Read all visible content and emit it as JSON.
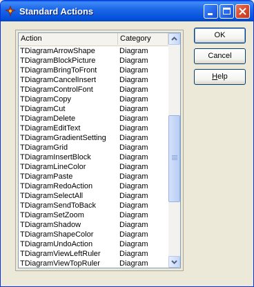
{
  "window": {
    "title": "Standard Actions"
  },
  "list": {
    "columns": [
      "Action",
      "Category"
    ],
    "rows": [
      [
        "TDiagramArrowShape",
        "Diagram"
      ],
      [
        "TDiagramBlockPicture",
        "Diagram"
      ],
      [
        "TDiagramBringToFront",
        "Diagram"
      ],
      [
        "TDiagramCancelInsert",
        "Diagram"
      ],
      [
        "TDiagramControlFont",
        "Diagram"
      ],
      [
        "TDiagramCopy",
        "Diagram"
      ],
      [
        "TDiagramCut",
        "Diagram"
      ],
      [
        "TDiagramDelete",
        "Diagram"
      ],
      [
        "TDiagramEditText",
        "Diagram"
      ],
      [
        "TDiagramGradientSetting",
        "Diagram"
      ],
      [
        "TDiagramGrid",
        "Diagram"
      ],
      [
        "TDiagramInsertBlock",
        "Diagram"
      ],
      [
        "TDiagramLineColor",
        "Diagram"
      ],
      [
        "TDiagramPaste",
        "Diagram"
      ],
      [
        "TDiagramRedoAction",
        "Diagram"
      ],
      [
        "TDiagramSelectAll",
        "Diagram"
      ],
      [
        "TDiagramSendToBack",
        "Diagram"
      ],
      [
        "TDiagramSetZoom",
        "Diagram"
      ],
      [
        "TDiagramShadow",
        "Diagram"
      ],
      [
        "TDiagramShapeColor",
        "Diagram"
      ],
      [
        "TDiagramUndoAction",
        "Diagram"
      ],
      [
        "TDiagramViewLeftRuler",
        "Diagram"
      ],
      [
        "TDiagramViewTopRuler",
        "Diagram"
      ]
    ]
  },
  "buttons": {
    "ok": "OK",
    "cancel": "Cancel",
    "help_underlined": "H",
    "help_rest": "elp"
  },
  "icons": {
    "app": "delphi-app-icon",
    "minimize": "minimize-icon",
    "maximize": "maximize-icon",
    "close": "close-icon",
    "scroll_up": "up-arrow-icon",
    "scroll_down": "down-arrow-icon"
  },
  "colors": {
    "titlebar": "#0551DD",
    "face": "#ECE9D8",
    "close_button": "#D4472A"
  }
}
